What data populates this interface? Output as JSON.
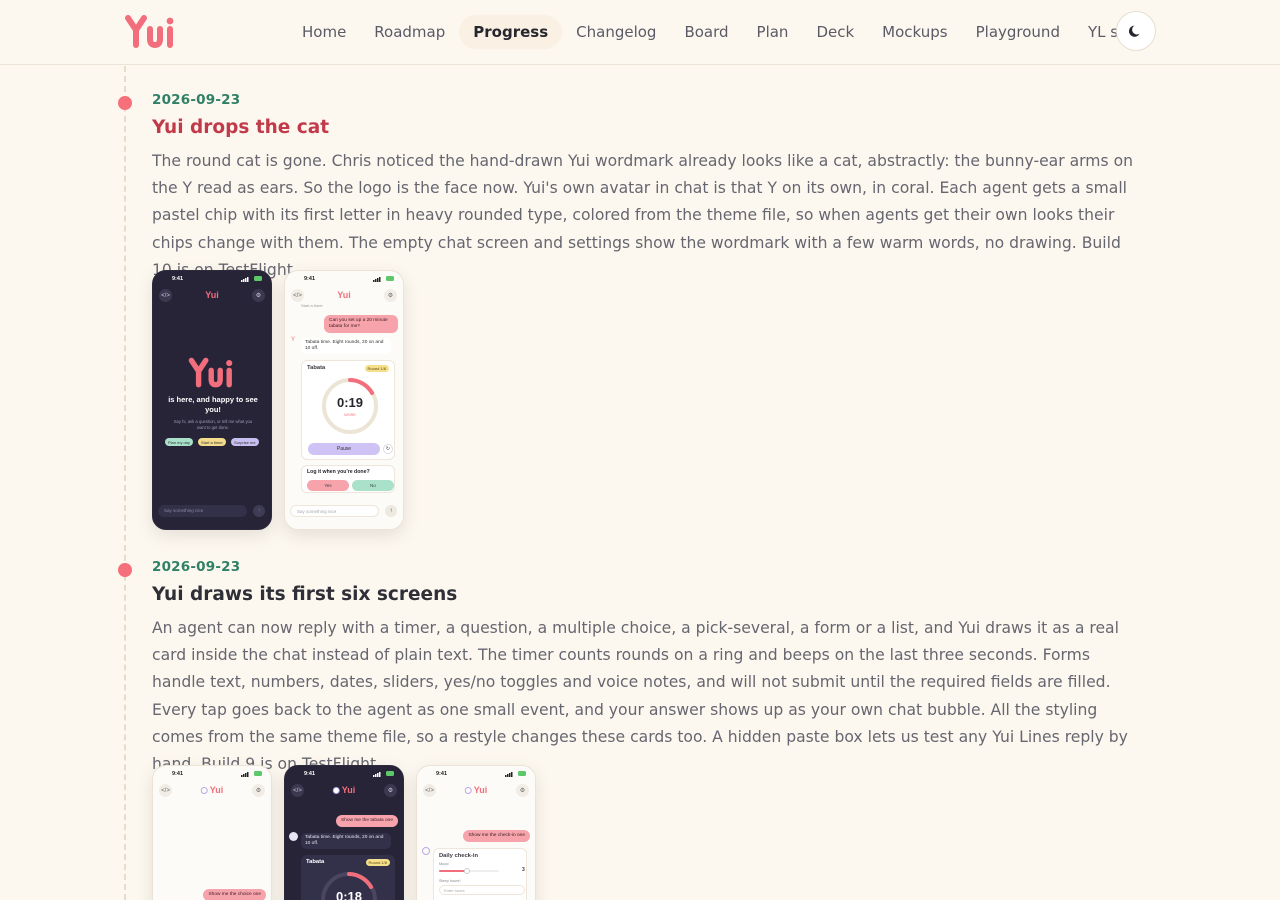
{
  "brand": {
    "name": "Yui",
    "accent": "#f26e7c",
    "green": "#2f8066",
    "bg": "#fdf8ef"
  },
  "nav": {
    "items": [
      {
        "label": "Home",
        "active": false
      },
      {
        "label": "Roadmap",
        "active": false
      },
      {
        "label": "Progress",
        "active": true
      },
      {
        "label": "Changelog",
        "active": false
      },
      {
        "label": "Board",
        "active": false
      },
      {
        "label": "Plan",
        "active": false
      },
      {
        "label": "Deck",
        "active": false
      },
      {
        "label": "Mockups",
        "active": false
      },
      {
        "label": "Playground",
        "active": false
      },
      {
        "label": "YL spec",
        "active": false
      }
    ],
    "theme_icon": "moon-icon"
  },
  "entries": [
    {
      "date": "2026-09-23",
      "title": "Yui drops the cat",
      "body": "The round cat is gone. Chris noticed the hand-drawn Yui wordmark already looks like a cat, abstractly: the bunny-ear arms on the Y read as ears. So the logo is the face now. Yui's own avatar in chat is that Y on its own, in coral. Each agent gets a small pastel chip with its first letter in heavy rounded type, colored from the theme file, so when agents get their own looks their chips change with them. The empty chat screen and settings show the wordmark with a few warm words, no drawing. Build 10 is on TestFlight.",
      "shots": {
        "empty": {
          "time": "9:41",
          "wordmark": "Yui",
          "headline": "is here, and happy to see you!",
          "sub": "Say hi, ask a question, or tell me what you want to get done.",
          "chips": [
            "Plan my day",
            "Start a timer",
            "Surprise me"
          ],
          "input": "Say something nice"
        },
        "timer": {
          "time": "9:41",
          "wordmark": "Yui",
          "top_text": "Start a timer",
          "user_msg": "Can you set up a 20 minute tabata for me?",
          "agent_msg": "Tabata time. Eight rounds, 20 on and 10 off.",
          "card_title": "Tabata",
          "badge": "Round 1/8",
          "time_left": "0:19",
          "phase": "WORK",
          "pause": "Pause",
          "question": "Log it when you're done?",
          "yes": "Yes",
          "no": "No",
          "input": "Say something nice"
        }
      }
    },
    {
      "date": "2026-09-23",
      "title": "Yui draws its first six screens",
      "body": "An agent can now reply with a timer, a question, a multiple choice, a pick-several, a form or a list, and Yui draws it as a real card inside the chat instead of plain text. The timer counts rounds on a ring and beeps on the last three seconds. Forms handle text, numbers, dates, sliders, yes/no toggles and voice notes, and will not submit until the required fields are filled. Every tap goes back to the agent as one small event, and your answer shows up as your own chat bubble. All the styling comes from the same theme file, so a restyle changes these cards too. A hidden paste box lets us test any Yui Lines reply by hand. Build 9 is on TestFlight.",
      "shots": {
        "choice": {
          "time": "9:41",
          "wordmark": "Yui",
          "user_msg": "Show me the choice one"
        },
        "timer_dark": {
          "time": "9:41",
          "wordmark": "Yui",
          "user_msg": "Show me the tabata one",
          "agent_msg": "Tabata time. Eight rounds, 20 on and 10 off.",
          "card_title": "Tabata",
          "badge": "Round 1/8",
          "time_left": "0:18"
        },
        "form": {
          "time": "9:41",
          "wordmark": "Yui",
          "user_msg": "Show me the check-in one",
          "card_title": "Daily check-in",
          "field1": "Mood",
          "field1_value": "3",
          "field2": "Sleep hours*",
          "field2_placeholder": "Enter hours"
        }
      }
    }
  ]
}
